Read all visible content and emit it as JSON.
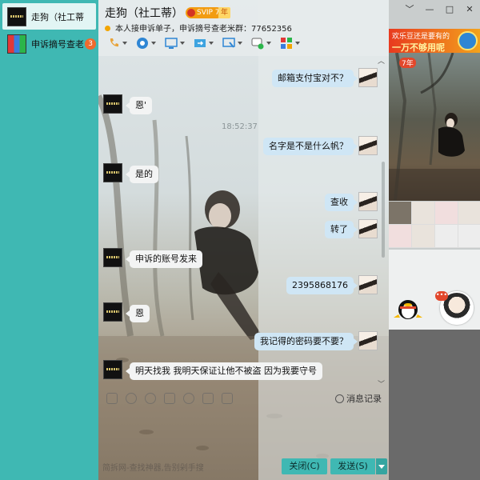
{
  "sessions": [
    {
      "name": "走狗（社工蒂）",
      "active": true
    },
    {
      "name": "申诉摘号查老米群",
      "badge": "3",
      "avatar_text": "源 然 服"
    }
  ],
  "header": {
    "contact_name": "走狗（社工蒂）",
    "vip_label": "SVIP 7",
    "years_label": "年",
    "signature": "本人接申诉单子，申诉摘号查老米群：77652356"
  },
  "toolbar": {
    "icons": [
      "phone-icon",
      "video-icon",
      "screen-share-icon",
      "file-transfer-icon",
      "remote-desktop-icon",
      "group-chat-icon",
      "apps-icon"
    ]
  },
  "timestamp": "18:52:37",
  "messages": [
    {
      "side": "mine",
      "text": "邮箱支付宝对不？"
    },
    {
      "side": "theirs",
      "text": "恩'"
    },
    {
      "side": "mine",
      "text": "名字是不是什么帆？"
    },
    {
      "side": "theirs",
      "text": "是的"
    },
    {
      "side": "mine",
      "text": "查收"
    },
    {
      "side": "mine",
      "text": "转了"
    },
    {
      "side": "theirs",
      "text": "申诉的账号发来"
    },
    {
      "side": "mine",
      "text": "2395868176"
    },
    {
      "side": "theirs",
      "text": "恩"
    },
    {
      "side": "mine",
      "text": "我记得的密码要不要？"
    },
    {
      "side": "theirs",
      "text": "明天找我 我明天保证让他不被盗 因为我要守号"
    }
  ],
  "input_toolbar": {
    "history_label": "消息记录"
  },
  "footer": {
    "hint": "简拆网-查找神器,告别剁手搜",
    "close_label": "关闭(C)",
    "send_label": "发送(S)"
  },
  "window_controls": [
    "chevron-down-icon",
    "minimize-icon",
    "maximize-icon",
    "close-icon"
  ],
  "right_panel": {
    "ad_line1": "欢乐豆还是要有的",
    "ad_line2": "一万不够用呢",
    "photo_years": "7年",
    "me_badge": "•••"
  }
}
